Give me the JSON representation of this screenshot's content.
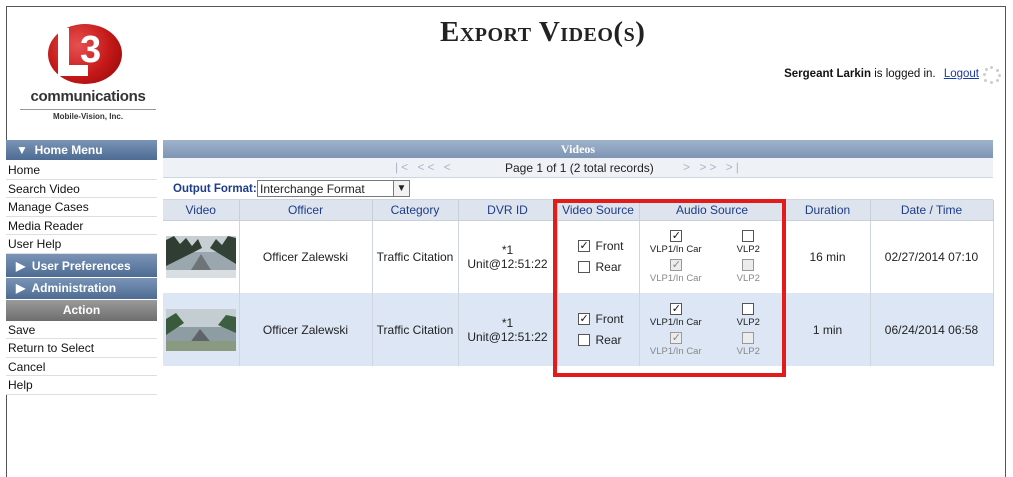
{
  "header": {
    "title": "Export Video(s)",
    "logo_text": "communications",
    "logo_sub": "Mobile-Vision, Inc.",
    "user_name": "Sergeant Larkin",
    "logged_in_text": "is logged in.",
    "logout_label": "Logout"
  },
  "sidebar": {
    "home_menu": "Home Menu",
    "items": [
      "Home",
      "Search Video",
      "Manage Cases",
      "Media Reader",
      "User Help"
    ],
    "user_prefs": "User Preferences",
    "admin": "Administration",
    "action_head": "Action",
    "actions": [
      "Save",
      "Return to Select",
      "Cancel",
      "Help"
    ]
  },
  "panel": {
    "title": "Videos",
    "pager_info": "Page 1 of 1 (2 total records)",
    "output_format_label": "Output Format:",
    "output_format_value": "Interchange Format",
    "columns": [
      "Video",
      "Officer",
      "Category",
      "DVR ID",
      "Video Source",
      "Audio Source",
      "Duration",
      "Date / Time"
    ]
  },
  "rows": [
    {
      "officer": "Officer Zalewski",
      "category": "Traffic Citation",
      "dvr_line1": "*1",
      "dvr_line2": "Unit@12:51:22",
      "front_label": "Front",
      "rear_label": "Rear",
      "front_checked": true,
      "rear_checked": false,
      "audio": [
        "VLP1/In Car",
        "VLP2",
        "VLP1/In Car",
        "VLP2"
      ],
      "duration": "16 min",
      "datetime": "02/27/2014 07:10"
    },
    {
      "officer": "Officer Zalewski",
      "category": "Traffic Citation",
      "dvr_line1": "*1",
      "dvr_line2": "Unit@12:51:22",
      "front_label": "Front",
      "rear_label": "Rear",
      "front_checked": true,
      "rear_checked": false,
      "audio": [
        "VLP1/In Car",
        "VLP2",
        "VLP1/In Car",
        "VLP2"
      ],
      "duration": "1 min",
      "datetime": "06/24/2014 06:58"
    }
  ],
  "colors": {
    "menu_blue": "#4d6b93",
    "header_link": "#1d3c8a",
    "highlight_red": "#e31b1b",
    "row_alt": "#dce6f5"
  }
}
